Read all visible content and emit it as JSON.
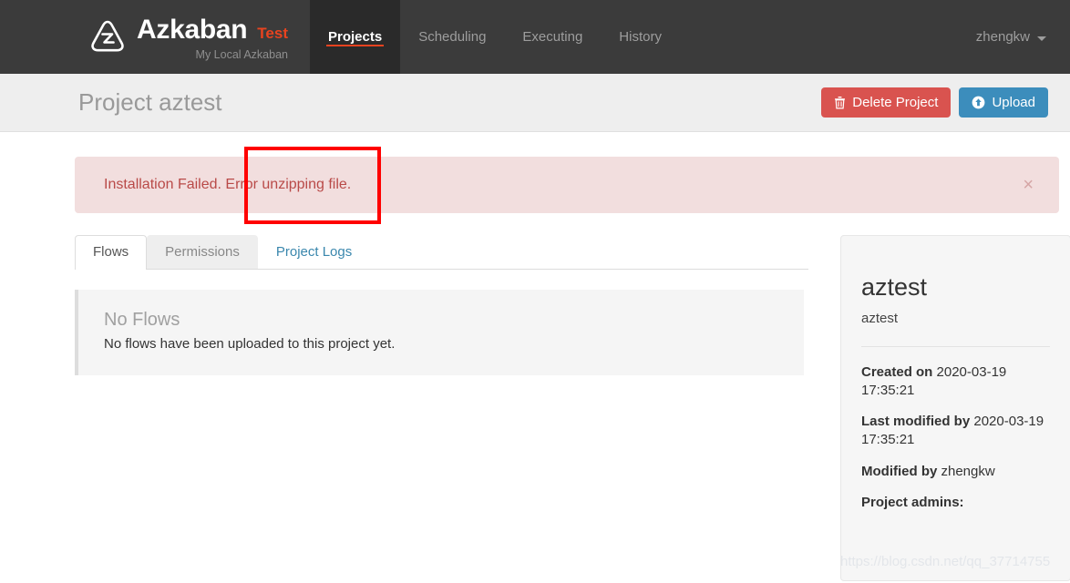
{
  "navbar": {
    "brand_name": "Azkaban",
    "brand_label": "Test",
    "brand_tagline": "My Local Azkaban",
    "links": [
      {
        "label": "Projects",
        "active": true
      },
      {
        "label": "Scheduling",
        "active": false
      },
      {
        "label": "Executing",
        "active": false
      },
      {
        "label": "History",
        "active": false
      }
    ],
    "user": "zhengkw",
    "accent_color": "#e8431f",
    "background_color": "#3b3b3b"
  },
  "page_header": {
    "title": "Project aztest",
    "delete_button": "Delete Project",
    "upload_button": "Upload",
    "delete_color": "#d9534f",
    "upload_color": "#3c8dbc"
  },
  "alert": {
    "message": "Installation Failed. Error unzipping file.",
    "close_label": "×",
    "background_color": "#f2dede",
    "text_color": "#b94a48"
  },
  "tabs": [
    {
      "label": "Flows",
      "state": "active"
    },
    {
      "label": "Permissions",
      "state": "hovered"
    },
    {
      "label": "Project Logs",
      "state": "link"
    }
  ],
  "empty_state": {
    "heading": "No Flows",
    "message": "No flows have been uploaded to this project yet."
  },
  "sidebar": {
    "project_name": "aztest",
    "project_description": "aztest",
    "details": [
      {
        "label": "Created on",
        "value": "2020-03-19 17:35:21"
      },
      {
        "label": "Last modified by",
        "value": "2020-03-19 17:35:21"
      },
      {
        "label": "Modified by",
        "value": "zhengkw"
      },
      {
        "label": "Project admins:",
        "value": ""
      }
    ]
  },
  "overlay": {
    "watermark": "https://blog.csdn.net/qq_37714755",
    "annotation_color": "#ff0000"
  }
}
